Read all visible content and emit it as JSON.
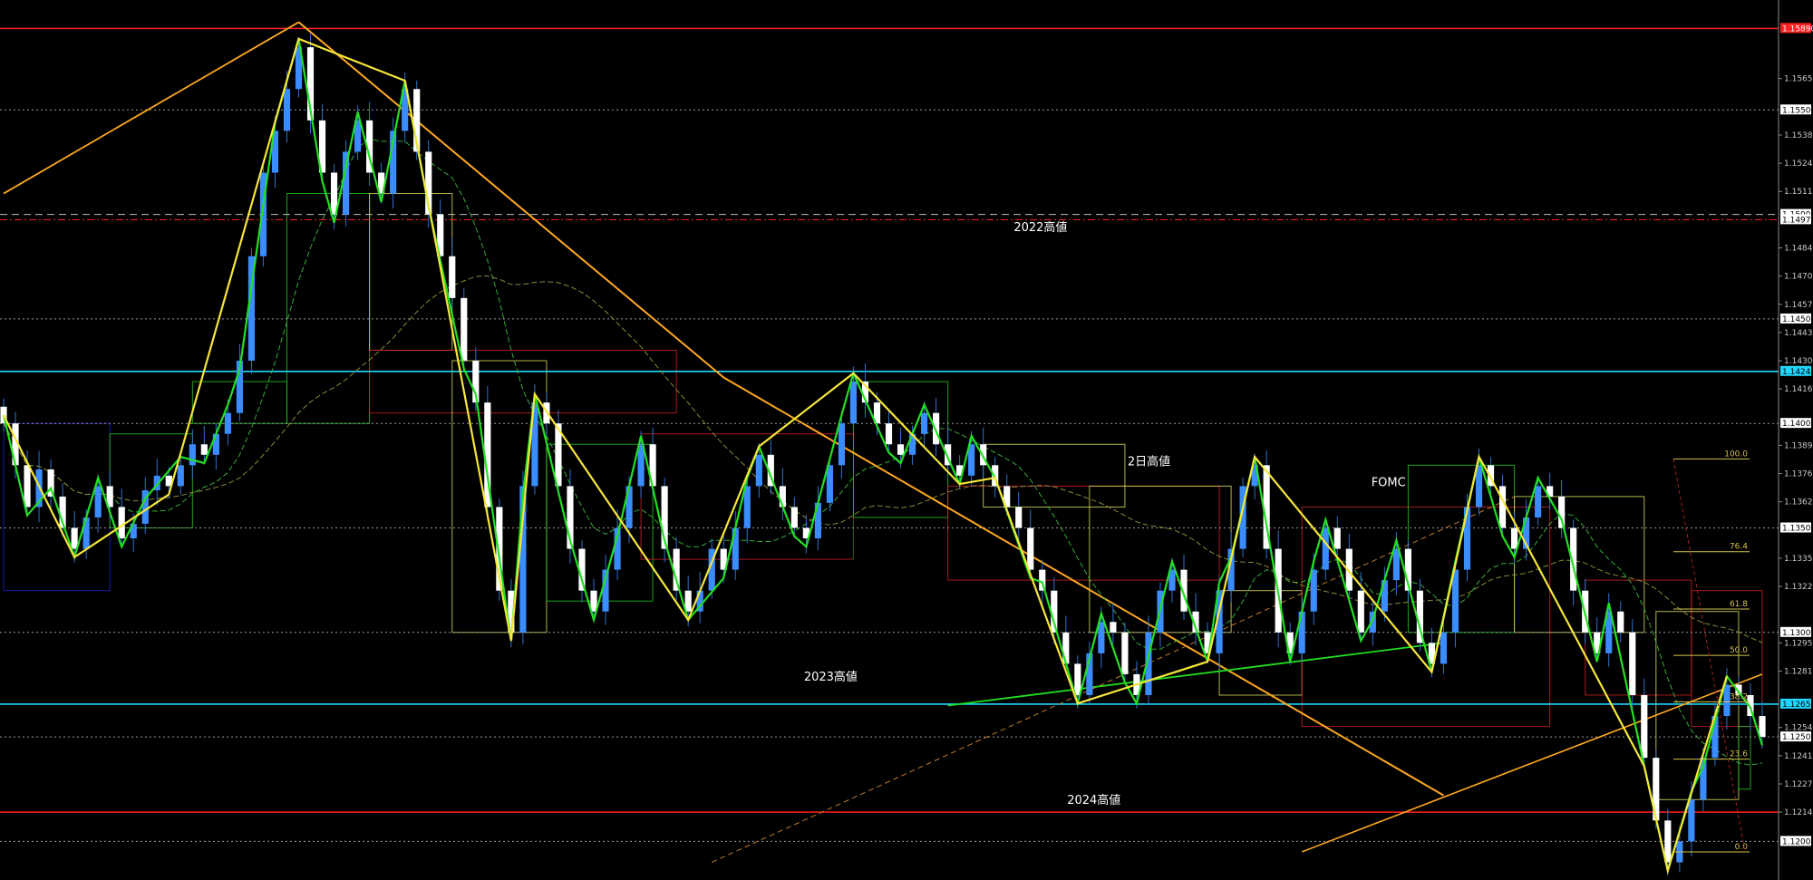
{
  "chart_data": {
    "type": "candlestick",
    "price_axis": {
      "range": [
        1.1185,
        1.16
      ],
      "ticks": [
        "1.15650",
        "1.15380",
        "1.15245",
        "1.15110",
        "1.14840",
        "1.14705",
        "1.14570",
        "1.14435",
        "1.14300",
        "1.14165",
        "1.13895",
        "1.13760",
        "1.13625",
        "1.13355",
        "1.13220",
        "1.12950",
        "1.12815",
        "1.12545",
        "1.12410",
        "1.12275",
        "1.12140"
      ]
    },
    "horizontal_levels": [
      {
        "price": 1.1589,
        "color": "#ff2020",
        "style": "solid",
        "tag": "1.15890",
        "tag_bg": "#ff2020",
        "tag_fg": "#ffffff"
      },
      {
        "price": 1.155,
        "color": "#9a9a9a",
        "style": "dotted",
        "tag": "1.15500",
        "tag_bg": "#ffffff",
        "tag_fg": "#000000"
      },
      {
        "price": 1.15,
        "color": "#bdbdbd",
        "style": "dashed",
        "tag": "1.15000",
        "tag_bg": "#ffffff",
        "tag_fg": "#000000"
      },
      {
        "price": 1.14975,
        "color": "#ff2020",
        "style": "dashdot",
        "tag": "1.14975",
        "tag_bg": "#ffffff",
        "tag_fg": "#000000"
      },
      {
        "price": 1.145,
        "color": "#9a9a9a",
        "style": "dotted",
        "tag": "1.14500",
        "tag_bg": "#ffffff",
        "tag_fg": "#000000"
      },
      {
        "price": 1.14249,
        "color": "#20d8ff",
        "style": "solid",
        "tag": "1.14249",
        "tag_bg": "#20d8ff",
        "tag_fg": "#000000"
      },
      {
        "price": 1.14,
        "color": "#9a9a9a",
        "style": "dotted",
        "tag": "1.14000",
        "tag_bg": "#ffffff",
        "tag_fg": "#000000"
      },
      {
        "price": 1.135,
        "color": "#9a9a9a",
        "style": "dotted",
        "tag": "1.13500",
        "tag_bg": "#ffffff",
        "tag_fg": "#000000"
      },
      {
        "price": 1.13,
        "color": "#9a9a9a",
        "style": "dotted",
        "tag": "1.13000",
        "tag_bg": "#ffffff",
        "tag_fg": "#000000"
      },
      {
        "price": 1.12657,
        "color": "#20d8ff",
        "style": "solid",
        "tag": "1.12657",
        "tag_bg": "#20d8ff",
        "tag_fg": "#000000"
      },
      {
        "price": 1.125,
        "color": "#9a9a9a",
        "style": "dotted",
        "tag": "1.12500",
        "tag_bg": "#ffffff",
        "tag_fg": "#000000"
      },
      {
        "price": 1.1214,
        "color": "#ff2020",
        "style": "solid",
        "tag": "",
        "tag_bg": "",
        "tag_fg": ""
      },
      {
        "price": 1.12,
        "color": "#9a9a9a",
        "style": "dotted",
        "tag": "1.12000",
        "tag_bg": "#ffffff",
        "tag_fg": "#000000"
      }
    ],
    "annotations": [
      {
        "text": "2022高値",
        "price": 1.1492,
        "col": 0.57
      },
      {
        "text": "2日高値",
        "price": 1.138,
        "col": 0.634
      },
      {
        "text": "FOMC",
        "price": 1.137,
        "col": 0.771
      },
      {
        "text": "2023高値",
        "price": 1.1277,
        "col": 0.452
      },
      {
        "text": "2024高値",
        "price": 1.1218,
        "col": 0.6
      }
    ],
    "fibonacci": {
      "levels": [
        "100.0",
        "76.4",
        "61.8",
        "50.0",
        "38.2",
        "23.6",
        "0.0"
      ],
      "high": 1.1383,
      "low": 1.1195,
      "color": "#d4c24a"
    },
    "series": [
      {
        "name": "",
        "values": [
          1.14,
          1.138,
          1.136,
          1.1378,
          1.1365,
          1.135,
          1.134,
          1.1355,
          1.137,
          1.136,
          1.1345,
          1.1352,
          1.1368,
          1.1375,
          1.137,
          1.138,
          1.139,
          1.1385,
          1.1395,
          1.1405,
          1.143,
          1.148,
          1.152,
          1.154,
          1.156,
          1.158,
          1.1545,
          1.152,
          1.15,
          1.153,
          1.1545,
          1.152,
          1.151,
          1.154,
          1.156,
          1.153,
          1.15,
          1.148,
          1.146,
          1.143,
          1.141,
          1.136,
          1.132,
          1.13,
          1.137,
          1.141,
          1.14,
          1.137,
          1.134,
          1.132,
          1.131,
          1.133,
          1.135,
          1.137,
          1.139,
          1.137,
          1.134,
          1.132,
          1.131,
          1.132,
          1.134,
          1.133,
          1.135,
          1.137,
          1.1385,
          1.137,
          1.136,
          1.135,
          1.1345,
          1.1362,
          1.138,
          1.14,
          1.142,
          1.141,
          1.14,
          1.139,
          1.1385,
          1.1395,
          1.1405,
          1.139,
          1.138,
          1.1375,
          1.139,
          1.138,
          1.137,
          1.136,
          1.135,
          1.133,
          1.132,
          1.13,
          1.1285,
          1.127,
          1.129,
          1.1305,
          1.13,
          1.128,
          1.127,
          1.13,
          1.132,
          1.133,
          1.131,
          1.13,
          1.129,
          1.132,
          1.134,
          1.137,
          1.138,
          1.134,
          1.13,
          1.129,
          1.131,
          1.133,
          1.135,
          1.134,
          1.132,
          1.13,
          1.131,
          1.1325,
          1.134,
          1.132,
          1.1295,
          1.1285,
          1.13,
          1.133,
          1.136,
          1.138,
          1.137,
          1.135,
          1.134,
          1.1355,
          1.137,
          1.1365,
          1.135,
          1.132,
          1.13,
          1.129,
          1.131,
          1.13,
          1.127,
          1.124,
          1.121,
          1.119,
          1.12,
          1.122,
          1.124,
          1.126,
          1.1275,
          1.127,
          1.126,
          1.125
        ]
      }
    ]
  }
}
